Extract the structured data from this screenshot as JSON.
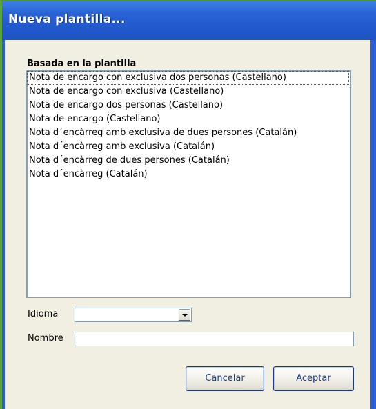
{
  "window": {
    "title": "Nueva plantilla..."
  },
  "template_section": {
    "label": "Basada en la plantilla",
    "items": [
      "Nota de encargo con exclusiva dos personas (Castellano)",
      "Nota de encargo con exclusiva (Castellano)",
      "Nota de encargo dos personas (Castellano)",
      "Nota de encargo (Castellano)",
      "Nota d´encàrreg amb exclusiva de dues persones (Catalán)",
      "Nota d´encàrreg amb exclusiva (Catalán)",
      "Nota d´encàrreg de dues persones (Catalán)",
      "Nota d´encàrreg (Catalán)"
    ],
    "focused_index": 0
  },
  "form": {
    "idioma_label": "Idioma",
    "idioma_value": "",
    "nombre_label": "Nombre",
    "nombre_value": ""
  },
  "buttons": {
    "cancel_label": "Cancelar",
    "accept_label": "Aceptar"
  },
  "icons": {
    "combo_arrow": "chevron-down-icon"
  },
  "colors": {
    "titlebar": "#2158cc",
    "dialog_background": "#f1efe2",
    "button_text": "#1f3f8c"
  }
}
